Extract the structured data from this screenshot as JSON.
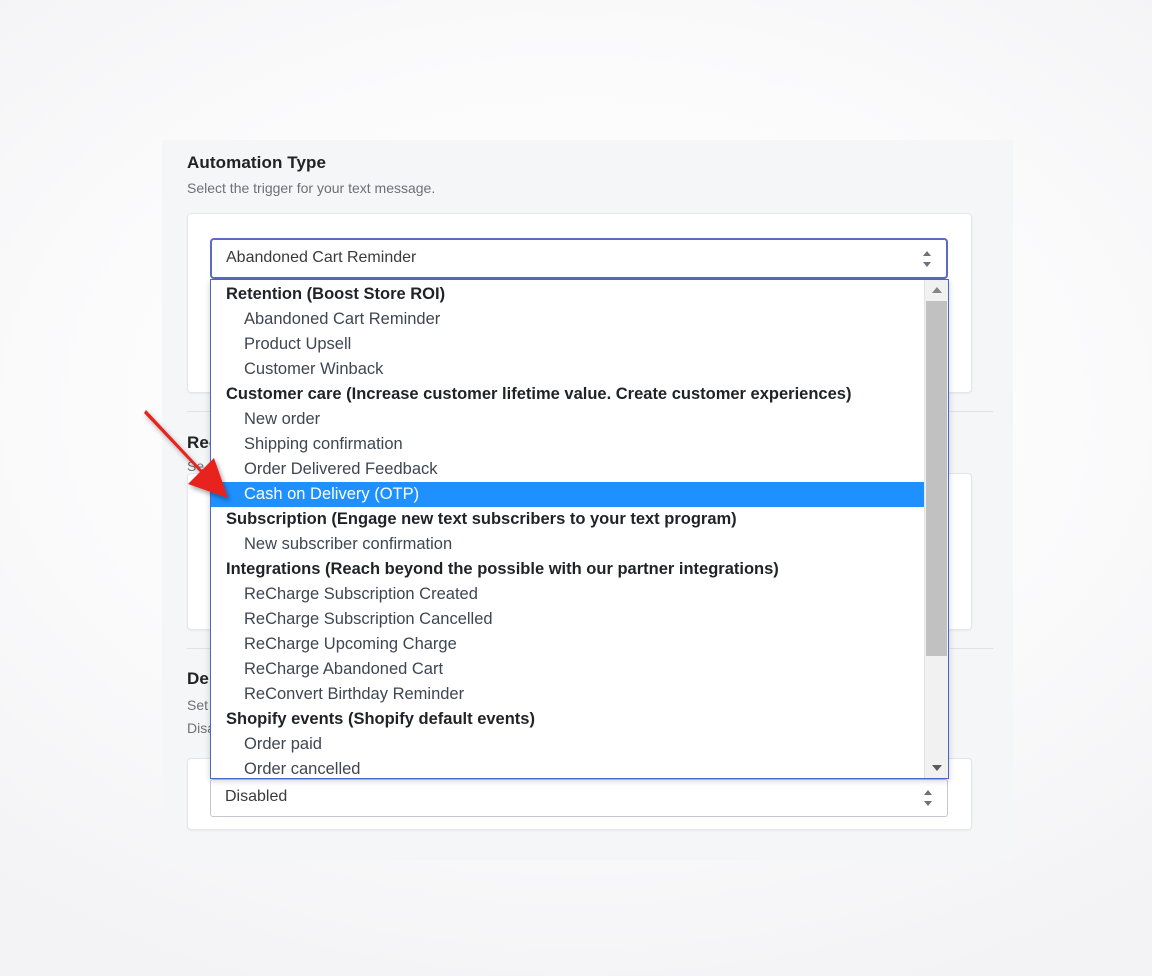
{
  "sections": {
    "automation": {
      "title": "Automation Type",
      "subtitle": "Select the trigger for your text message.",
      "selected_value": "Abandoned Cart Reminder"
    },
    "recurring": {
      "title_visible": "Rec",
      "subtitle_visible": "Se"
    },
    "delivery": {
      "title_visible": "De",
      "subtitle_line1_visible": "Set",
      "subtitle_line2_visible": "Disa",
      "selected_value": "Disabled"
    }
  },
  "dropdown": {
    "options": [
      {
        "label": "Retention (Boost Store ROI)",
        "type": "group",
        "selected": false
      },
      {
        "label": "Abandoned Cart Reminder",
        "type": "item",
        "selected": false
      },
      {
        "label": "Product Upsell",
        "type": "item",
        "selected": false
      },
      {
        "label": "Customer Winback",
        "type": "item",
        "selected": false
      },
      {
        "label": "Customer care (Increase customer lifetime value. Create customer experiences)",
        "type": "group",
        "selected": false
      },
      {
        "label": "New order",
        "type": "item",
        "selected": false
      },
      {
        "label": "Shipping confirmation",
        "type": "item",
        "selected": false
      },
      {
        "label": "Order Delivered Feedback",
        "type": "item",
        "selected": false
      },
      {
        "label": "Cash on Delivery (OTP)",
        "type": "item",
        "selected": true
      },
      {
        "label": "Subscription (Engage new text subscribers to your text program)",
        "type": "group",
        "selected": false
      },
      {
        "label": "New subscriber confirmation",
        "type": "item",
        "selected": false
      },
      {
        "label": "Integrations (Reach beyond the possible with our partner integrations)",
        "type": "group",
        "selected": false
      },
      {
        "label": "ReCharge Subscription Created",
        "type": "item",
        "selected": false
      },
      {
        "label": "ReCharge Subscription Cancelled",
        "type": "item",
        "selected": false
      },
      {
        "label": "ReCharge Upcoming Charge",
        "type": "item",
        "selected": false
      },
      {
        "label": "ReCharge Abandoned Cart",
        "type": "item",
        "selected": false
      },
      {
        "label": "ReConvert Birthday Reminder",
        "type": "item",
        "selected": false
      },
      {
        "label": "Shopify events (Shopify default events)",
        "type": "group",
        "selected": false
      },
      {
        "label": "Order paid",
        "type": "item",
        "selected": false
      },
      {
        "label": "Order cancelled",
        "type": "item",
        "selected": false
      }
    ]
  },
  "colors": {
    "highlight": "#1e90ff",
    "focus_border": "#5c6ac4",
    "panel_bg": "#f4f6f8",
    "annotation_arrow": "#e8221d"
  }
}
